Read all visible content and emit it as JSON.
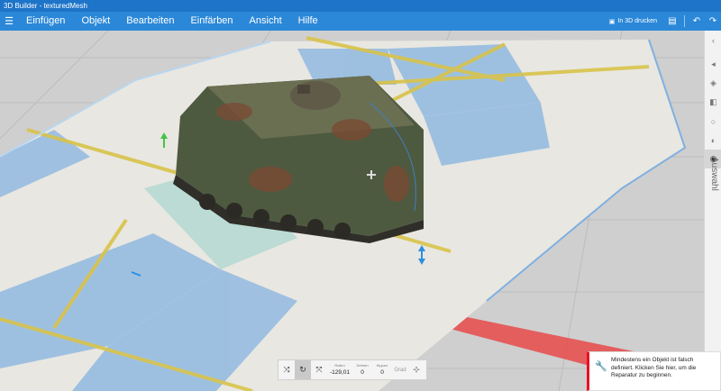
{
  "window": {
    "title": "3D Builder - texturedMesh"
  },
  "menu": {
    "items": [
      "Einfügen",
      "Objekt",
      "Bearbeiten",
      "Einfärben",
      "Ansicht",
      "Hilfe"
    ],
    "print_label": "In 3D drucken"
  },
  "sidebar": {
    "label": "Auswahl"
  },
  "toolbar": {
    "rotate_label": "Rollen",
    "rotate_value": "-129,01",
    "turn_label": "Drehen",
    "turn_value": "0",
    "tilt_label": "Kippen",
    "tilt_value": "0",
    "unit": "Grad"
  },
  "notification": {
    "text": "Mindestens ein Objekt ist falsch definiert. Klicken Sie hier, um die Reparatur zu beginnen."
  },
  "colors": {
    "title_bar": "#1e74c8",
    "menu_bar": "#2b88d8",
    "grid_background": "#cfcfcf",
    "notification_accent": "#e81123",
    "stripe_yellow": "#d8c34a",
    "stripe_blue": "#86b3e0",
    "axis_red": "#e84a4a"
  },
  "icons": {
    "menu": "hamburger-icon",
    "print": "printer-icon",
    "save": "save-icon",
    "undo": "undo-icon",
    "redo": "redo-icon",
    "notify": "wrench-icon"
  }
}
